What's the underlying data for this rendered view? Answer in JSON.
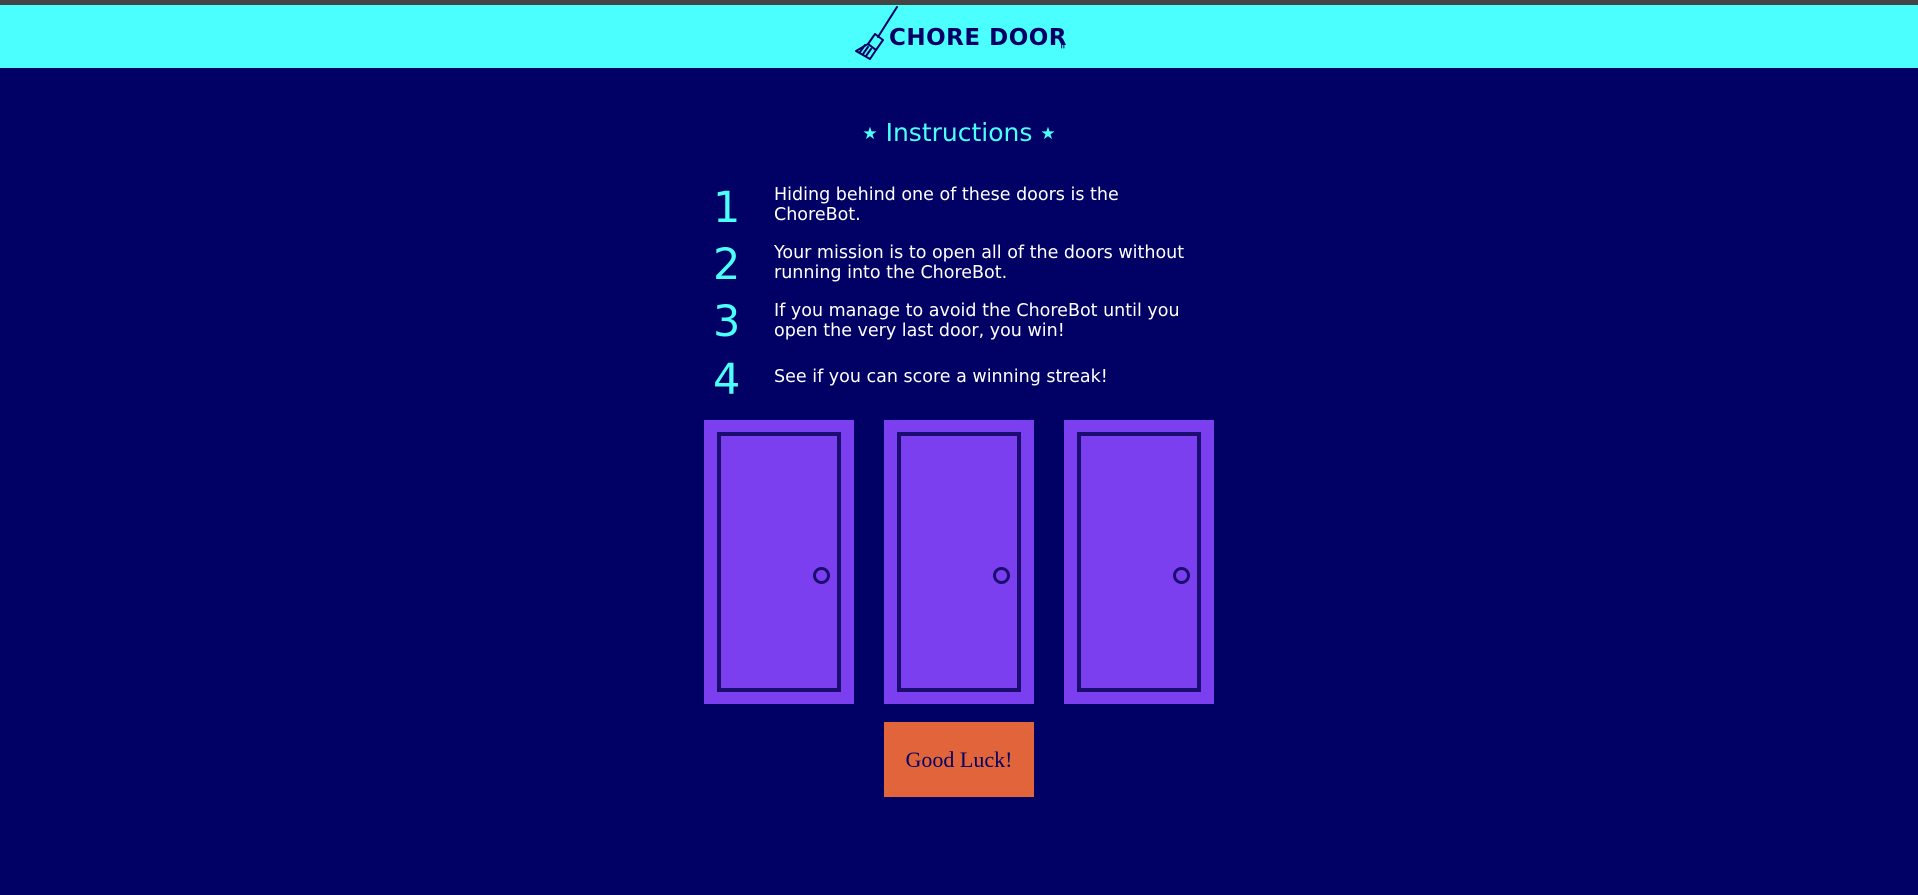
{
  "header": {
    "title": "CHORE DOOR",
    "mark": "\"",
    "logo_icon": "broom-icon"
  },
  "instructions": {
    "title": "Instructions",
    "star_icon": "★",
    "steps": [
      {
        "number": "1",
        "text": "Hiding behind one of these doors is the ChoreBot."
      },
      {
        "number": "2",
        "text": "Your mission is to open all of the doors without running into the ChoreBot."
      },
      {
        "number": "3",
        "text": "If you manage to avoid the ChoreBot until you open the very last door, you win!"
      },
      {
        "number": "4",
        "text": "See if you can score a winning streak!"
      }
    ]
  },
  "doors": [
    "door-1",
    "door-2",
    "door-3"
  ],
  "start_button": {
    "label": "Good Luck!"
  },
  "colors": {
    "background": "#010165",
    "header": "#4cffff",
    "accent": "#4cffff",
    "door": "#7c3ff0",
    "door_outline": "#1a0d70",
    "button": "#e2643a"
  }
}
